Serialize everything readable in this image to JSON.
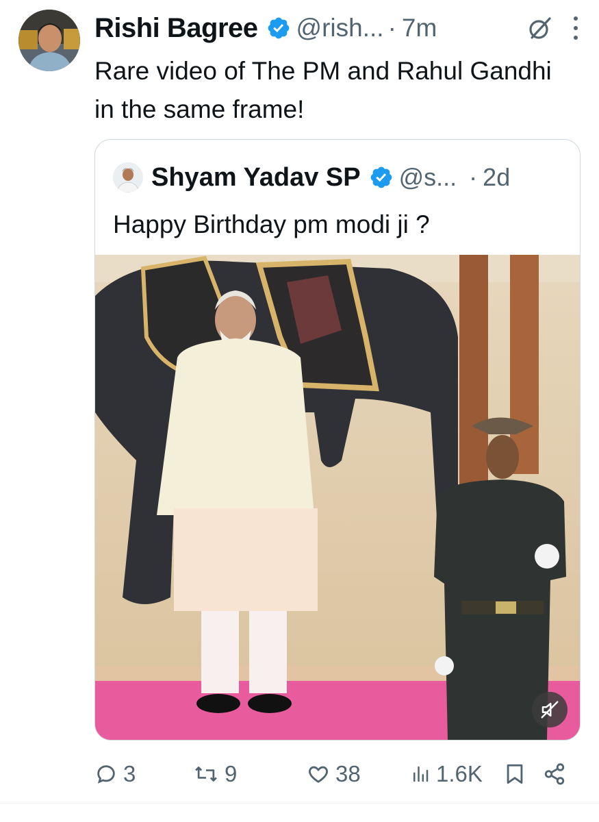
{
  "tweet": {
    "author_name": "Rishi Bagree",
    "author_handle": "@rish...",
    "separator": "·",
    "time": "7m",
    "text": "Rare video of The PM and Rahul Gandhi in the same frame!"
  },
  "quoted": {
    "author_name": "Shyam Yadav SP",
    "author_handle": "@s...",
    "separator": "·",
    "time": "2d",
    "text": "Happy Birthday pm modi ji ?"
  },
  "actions": {
    "replies": "3",
    "reposts": "9",
    "likes": "38",
    "views": "1.6K"
  },
  "colors": {
    "verified": "#1d9bf0",
    "secondary_text": "#536471",
    "border": "#cfd9de"
  },
  "icons": [
    "verified-badge-icon",
    "grok-icon",
    "more-icon",
    "muted-icon",
    "reply-icon",
    "repost-icon",
    "like-icon",
    "views-icon",
    "bookmark-icon",
    "share-icon"
  ]
}
